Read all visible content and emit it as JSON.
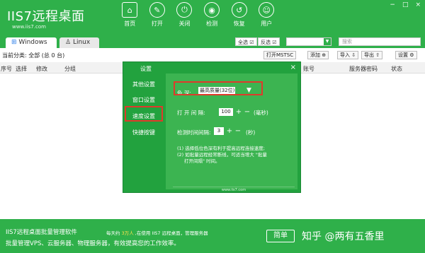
{
  "app": {
    "logo": "IIS7远程桌面",
    "url": "www.iis7.com"
  },
  "nav": [
    {
      "label": "首页",
      "icon": "home-icon",
      "glyph": "⌂"
    },
    {
      "label": "打开",
      "icon": "edit-icon",
      "glyph": "✎"
    },
    {
      "label": "关闭",
      "icon": "power-icon",
      "glyph": "⏻"
    },
    {
      "label": "检测",
      "icon": "gauge-icon",
      "glyph": "◉"
    },
    {
      "label": "恢复",
      "icon": "restore-icon",
      "glyph": "↺"
    },
    {
      "label": "用户",
      "icon": "user-icon",
      "glyph": "☺"
    }
  ],
  "window_controls": [
    "−",
    "□",
    "×"
  ],
  "tabs": {
    "windows": "Windows",
    "linux": "Linux"
  },
  "toolbar": {
    "select_all": "全选",
    "invert": "反选",
    "search_placeholder": "搜索",
    "current_category": "当前分类: 全部 (总 0 台)",
    "open_mstsc": "打开MSTSC",
    "add": "添加",
    "import": "导入",
    "export": "导出",
    "settings": "设置"
  },
  "columns": [
    "序号",
    "选择",
    "修改",
    "分组",
    "账号",
    "服务器密码",
    "状态"
  ],
  "modal": {
    "title": "设置",
    "close": "×",
    "sidebar": [
      "其他设置",
      "窗口设置",
      "速度设置",
      "快捷按键"
    ],
    "color_depth_label": "色 深:",
    "color_depth_value": "最高质量(32位)",
    "open_interval_label": "打 开 间 隔:",
    "open_interval_value": "100",
    "open_interval_unit": "(毫秒)",
    "check_interval_label": "检测时间间隔:",
    "check_interval_value": "3",
    "check_interval_unit": "(秒)",
    "note1": "(1) 选择低位色深有利于提高远程连接速度;",
    "note2": "(2) 如批量远程经常断线，可适当增大 \"批量",
    "note3": "打开间隔\" 时间。",
    "watermark": "www.iis7.com"
  },
  "footer": {
    "line1": "IIS7远程桌面批量管理软件",
    "line2": "批量管理VPS、云服务器、物理服务器，有效提高您的工作效率。",
    "mid_prefix": "每天约",
    "mid_highlight": "3万人",
    "mid_suffix": ",在使用 IIS7 远程桌面，管理服务器",
    "mode_button": "简单",
    "watermark": "知乎 @两有五香里"
  }
}
